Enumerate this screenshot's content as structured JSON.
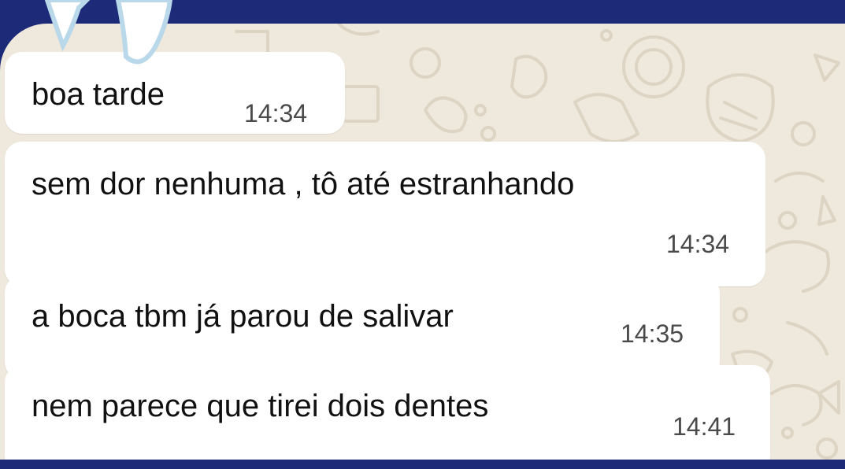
{
  "theme": {
    "frame_color": "#1c2a78",
    "chat_background": "#efe8dc",
    "bubble_color": "#ffffff",
    "text_color": "#111111",
    "time_color": "#4a4a4a"
  },
  "messages": [
    {
      "text": "boa tarde",
      "time": "14:34"
    },
    {
      "text": "sem dor nenhuma , tô até estranhando",
      "time": "14:34"
    },
    {
      "text": "a boca tbm já parou de salivar",
      "time": "14:35"
    },
    {
      "text": "nem parece que tirei dois dentes",
      "time": "14:41"
    }
  ],
  "decorations": {
    "sticker_icon": "tooth-sticker-icon",
    "wallpaper_icon": "doodle-wallpaper-icon"
  }
}
